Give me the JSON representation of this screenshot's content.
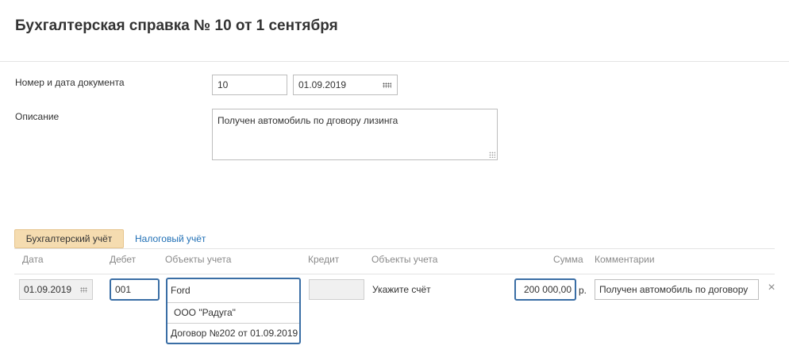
{
  "title": "Бухгалтерская справка № 10 от 1 сентября",
  "form": {
    "number_date_label": "Номер и дата документа",
    "number_value": "10",
    "date_value": "01.09.2019",
    "description_label": "Описание",
    "description_value": "Получен автомобиль по дговору лизинга"
  },
  "tabs": [
    {
      "label": "Бухгалтерский учёт",
      "active": true
    },
    {
      "label": "Налоговый учёт",
      "active": false
    }
  ],
  "table": {
    "headers": {
      "date": "Дата",
      "debit": "Дебет",
      "debit_objects": "Объекты учета",
      "credit": "Кредит",
      "credit_objects": "Объекты учета",
      "amount": "Сумма",
      "comments": "Комментарии"
    },
    "row": {
      "date": "01.09.2019",
      "debit": "001",
      "debit_objects": [
        "Ford",
        "ООО \"Радуга\"",
        "Договор №202 от 01.09.2019"
      ],
      "credit": "",
      "credit_hint": "Укажите счёт",
      "amount": "200 000,00",
      "currency": "р.",
      "comment": "Получен автомобиль по договору"
    }
  },
  "icons": {
    "calendar": "calendar-icon",
    "delete": "close-icon",
    "delete_glyph": "×"
  },
  "colors": {
    "active_tab_bg": "#f5dcb0",
    "link": "#1f6fb5",
    "focus_border": "#3a6ea5"
  }
}
